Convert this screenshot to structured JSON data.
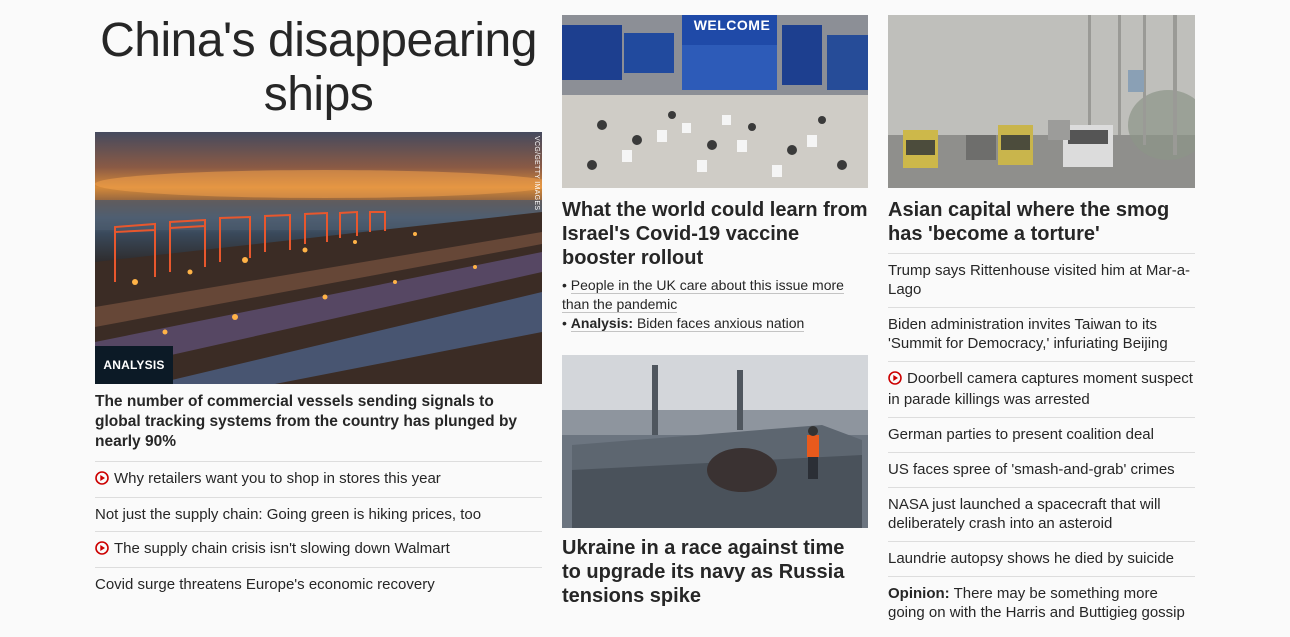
{
  "lead": {
    "title": "China's disappearing ships",
    "image_credit": "VCG/GETTY IMAGES",
    "tag": "ANALYSIS",
    "headline": "The number of commercial vessels sending signals to global tracking systems from the country has plunged by nearly 90%",
    "related": [
      {
        "label": "Why retailers want you to shop in stores this year",
        "video": true
      },
      {
        "label": "Not just the supply chain: Going green is hiking prices, too",
        "video": false
      },
      {
        "label": "The supply chain crisis isn't slowing down Walmart",
        "video": true
      },
      {
        "label": "Covid surge threatens Europe's economic recovery",
        "video": false
      }
    ]
  },
  "israel": {
    "image_sign": "WELCOME",
    "headline": "What the world could learn from Israel's Covid-19 vaccine booster rollout",
    "sub1": "People in the UK care about this issue more than the pandemic",
    "sub2_label": "Analysis:",
    "sub2": "Biden faces anxious nation"
  },
  "ukraine": {
    "headline": "Ukraine in a race against time to upgrade its navy as Russia tensions spike"
  },
  "smog": {
    "headline": "Asian capital where the smog has 'become a torture'",
    "items": [
      {
        "label": "Trump says Rittenhouse visited him at Mar-a-Lago",
        "video": false
      },
      {
        "label": "Biden administration invites Taiwan to its 'Summit for Democracy,' infuriating Beijing",
        "video": false
      },
      {
        "label": "Doorbell camera captures moment suspect in parade killings was arrested",
        "video": true
      },
      {
        "label": "German parties to present coalition deal",
        "video": false
      },
      {
        "label": "US faces spree of 'smash-and-grab' crimes",
        "video": false
      },
      {
        "label": "NASA just launched a spacecraft that will deliberately crash into an asteroid",
        "video": false
      },
      {
        "label": "Laundrie autopsy shows he died by suicide",
        "video": false
      }
    ],
    "opinion_label": "Opinion:",
    "opinion_text": "There may be something more going on with the Harris and Buttigieg gossip"
  },
  "colors": {
    "text": "#262626",
    "video_icon": "#cc0000",
    "tag_bg": "#0c1a26",
    "divider": "#dddddd"
  }
}
